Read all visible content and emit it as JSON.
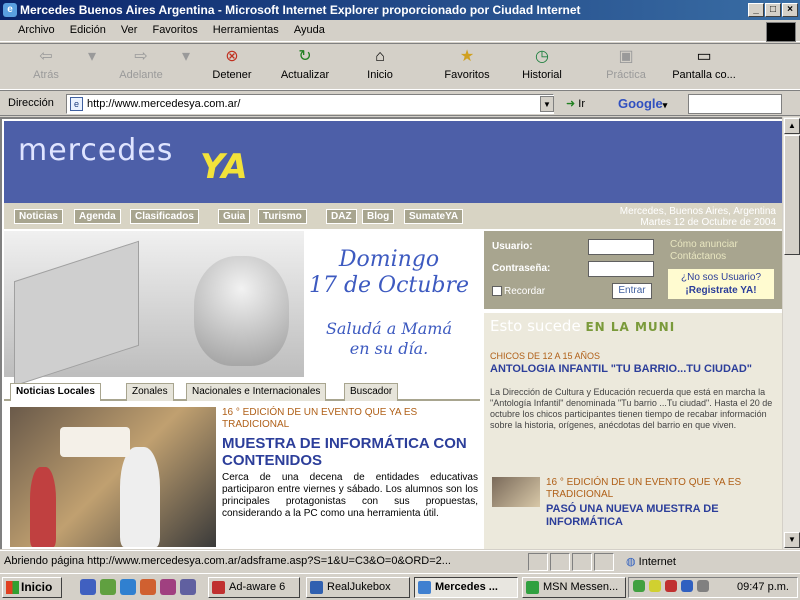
{
  "window": {
    "title": "Mercedes Buenos Aires Argentina - Microsoft Internet Explorer proporcionado por Ciudad Internet"
  },
  "menu": [
    "Archivo",
    "Edición",
    "Ver",
    "Favoritos",
    "Herramientas",
    "Ayuda"
  ],
  "toolbar": {
    "back": "Atrás",
    "forward": "Adelante",
    "stop": "Detener",
    "refresh": "Actualizar",
    "home": "Inicio",
    "favorites": "Favoritos",
    "history": "Historial",
    "mail": "Pantalla co...",
    "disabled_label": "Práctica"
  },
  "address": {
    "label": "Dirección",
    "url": "http://www.mercedesya.com.ar/",
    "go": "Ir",
    "google": "Google"
  },
  "site": {
    "logo_main": "mercedes",
    "logo_accent": "YA",
    "nav": [
      "Noticias",
      "Agenda",
      "Clasificados",
      "Guia",
      "Turismo",
      "DAZ",
      "Blog",
      "SumateYA"
    ],
    "location_line1": "Mercedes, Buenos Aires, Argentina",
    "location_line2": "Martes 12 de Octubre de 2004",
    "banner": {
      "date_line1": "Domingo",
      "date_line2": "17 de Octubre",
      "message_line1": "Saludá a Mamá",
      "message_line2": "en su día."
    },
    "tabs": [
      "Noticias Locales",
      "Zonales",
      "Nacionales e Internacionales",
      "Buscador"
    ],
    "news": {
      "kicker": "16 ° EDICIÓN DE UN EVENTO QUE YA ES TRADICIONAL",
      "title": "MUESTRA DE INFORMÁTICA CON CONTENIDOS",
      "body": "Cerca de una decena de entidades educativas participaron entre viernes y sábado. Los alumnos son los principales protagonistas con sus propuestas, considerando a la PC como una herramienta útil."
    },
    "login": {
      "user_label": "Usuario:",
      "password_label": "Contraseña:",
      "remember": "Recordar",
      "submit": "Entrar",
      "link1": "Cómo anunciar",
      "link2": "Contáctanos",
      "register_line1": "¿No sos Usuario?",
      "register_line2": "¡Registrate YA!"
    },
    "esto": {
      "heading": "Esto sucede",
      "heading_accent": "EN LA MUNI",
      "section": "CHICOS DE 12 A 15 AÑOS",
      "title": "ANTOLOGIA INFANTIL \"TU BARRIO...TU CIUDAD\"",
      "body": "La Dirección de Cultura y Educación recuerda que está en marcha la \"Antología Infantil\" denominada \"Tu barrio ...Tu ciudad\". Hasta el 20 de octubre los chicos participantes tienen tiempo de recabar información sobre la historia, orígenes, anécdotas del barrio en que viven.",
      "kicker2": "16 ° EDICIÓN DE UN EVENTO QUE YA ES TRADICIONAL",
      "title2": "PASÓ UNA NUEVA MUESTRA DE INFORMÁTICA"
    }
  },
  "status": {
    "text": "Abriendo página http://www.mercedesya.com.ar/adsframe.asp?S=1&U=C3&O=0&ORD=2...",
    "zone": "Internet"
  },
  "taskbar": {
    "start": "Inicio",
    "tasks": [
      "Ad-aware 6",
      "RealJukebox",
      "Mercedes ...",
      "MSN Messen..."
    ],
    "clock": "09:47 p.m."
  }
}
